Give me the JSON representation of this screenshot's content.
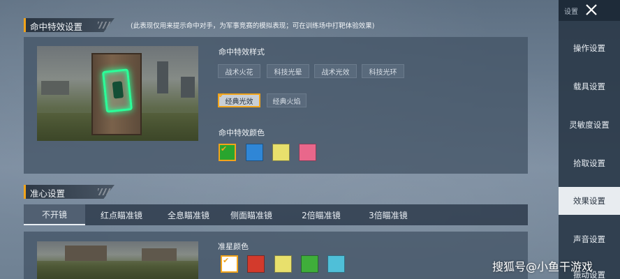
{
  "hit_effect": {
    "section_title": "命中特效设置",
    "hint": "(此表现仅用来提示命中对手，为军事竞赛的模拟表现；可在训练场中打靶体验效果)",
    "style_label": "命中特效样式",
    "styles": [
      "战术火花",
      "科技光晕",
      "战术光效",
      "科技光环"
    ],
    "styles_row2": [
      "经典光效",
      "经典火焰"
    ],
    "selected_style": "经典光效",
    "color_label": "命中特效颜色",
    "colors": [
      "#29a52e",
      "#2f86d6",
      "#e8e06c",
      "#e9678b"
    ],
    "selected_color_index": 0
  },
  "crosshair": {
    "section_title": "准心设置",
    "tabs": [
      "不开镜",
      "红点瞄准镜",
      "全息瞄准镜",
      "侧面瞄准镜",
      "2倍瞄准镜",
      "3倍瞄准镜"
    ],
    "active_tab_index": 0,
    "color_label": "准星颜色",
    "colors": [
      "#ffffff",
      "#d33a2c",
      "#e8e06c",
      "#3fae3a",
      "#4fbfd8"
    ],
    "selected_color_index": 0
  },
  "sidebar": {
    "title": "设置",
    "items": [
      "操作设置",
      "载具设置",
      "灵敏度设置",
      "拾取设置",
      "效果设置",
      "声音设置",
      "振动设置"
    ],
    "active_index": 4
  },
  "icons": {
    "close": "close-icon",
    "check": "check-icon"
  },
  "accent_color": "#f2a41a",
  "watermark": "搜狐号@小鱼干游戏"
}
